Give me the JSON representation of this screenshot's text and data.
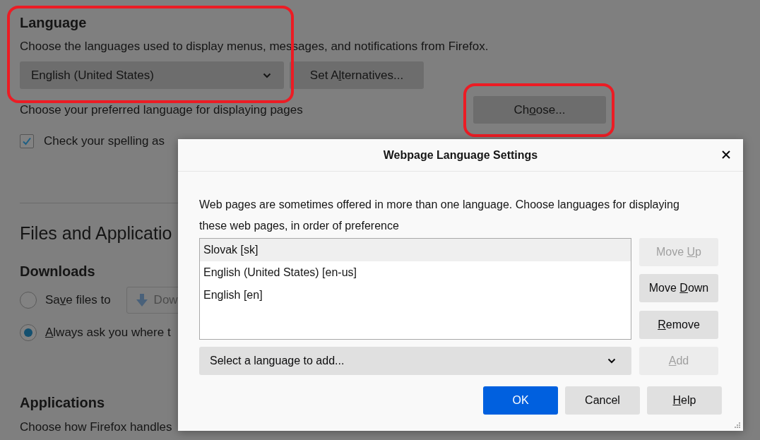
{
  "language": {
    "heading": "Language",
    "highlighted": true,
    "description": "Choose the languages used to display menus, messages, and notifications from Firefox.",
    "dropdown": {
      "value": "English (United States)"
    },
    "alternatives_button": {
      "pre": "Set A",
      "key": "l",
      "post": "ternatives..."
    },
    "preferred_label": "Choose your preferred language for displaying pages",
    "choose_button": {
      "label": {
        "pre": "Ch",
        "key": "o",
        "post": "ose..."
      },
      "highlighted": true
    },
    "spellcheck": {
      "label": "Check your spelling as",
      "checked": true
    }
  },
  "files": {
    "heading": "Files and Applicatio",
    "downloads_heading": "Downloads",
    "options": [
      {
        "kind": "folder",
        "label": {
          "pre": "Sa",
          "key": "v",
          "post": "e files to"
        },
        "selected": false,
        "folder_button": "Dow"
      },
      {
        "kind": "plain",
        "label": {
          "key": "A",
          "post": "lways ask you where t"
        },
        "selected": true
      }
    ],
    "applications_heading": "Applications",
    "applications_description": "Choose how Firefox handles"
  },
  "dialog": {
    "title": "Webpage Language Settings",
    "description": "Web pages are sometimes offered in more than one language. Choose languages for displaying these web pages, in order of preference",
    "languages": [
      {
        "label": "Slovak [sk]",
        "selected": true
      },
      {
        "label": "English (United States) [en-us]",
        "selected": false
      },
      {
        "label": "English [en]",
        "selected": false
      }
    ],
    "add_select": {
      "placeholder": "Select a language to add..."
    },
    "side_buttons": [
      {
        "label": {
          "pre": "Move ",
          "key": "U",
          "post": "p"
        },
        "disabled": true
      },
      {
        "label": {
          "pre": "Move ",
          "key": "D",
          "post": "own"
        },
        "disabled": false
      },
      {
        "label": {
          "key": "R",
          "post": "emove"
        },
        "disabled": false
      },
      {
        "label": {
          "key": "A",
          "post": "dd"
        },
        "disabled": true
      }
    ],
    "buttons": [
      {
        "kind": "primary",
        "label": "OK"
      },
      {
        "kind": "normal",
        "label": "Cancel"
      },
      {
        "kind": "normal",
        "label": {
          "key": "H",
          "post": "elp"
        }
      }
    ]
  }
}
